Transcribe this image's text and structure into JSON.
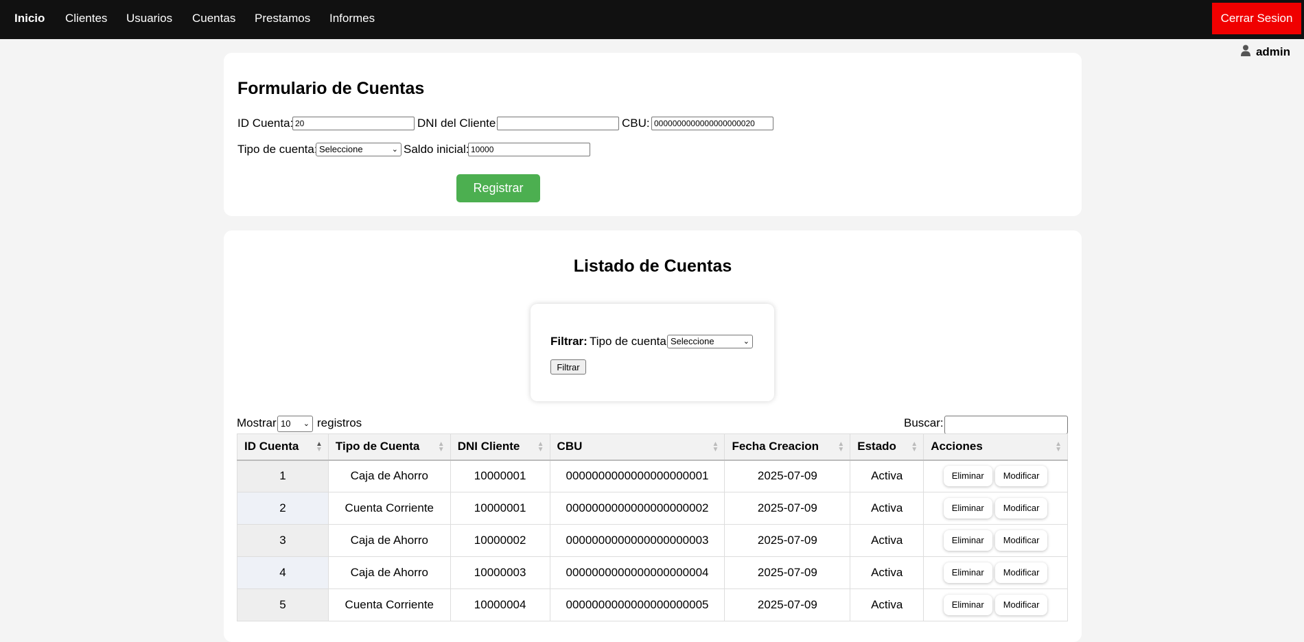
{
  "nav": {
    "items": [
      {
        "label": "Inicio",
        "active": true
      },
      {
        "label": "Clientes",
        "active": false
      },
      {
        "label": "Usuarios",
        "active": false
      },
      {
        "label": "Cuentas",
        "active": false
      },
      {
        "label": "Prestamos",
        "active": false
      },
      {
        "label": "Informes",
        "active": false
      }
    ],
    "logout_label": "Cerrar Sesion"
  },
  "user": {
    "name": "admin",
    "icon": "user-icon"
  },
  "form": {
    "title": "Formulario de Cuentas",
    "id_label": "ID Cuenta:",
    "id_value": "20",
    "dni_label": "DNI del Cliente:",
    "dni_value": "",
    "cbu_label": "CBU:",
    "cbu_value": "0000000000000000000020",
    "tipo_label": "Tipo de cuenta:",
    "tipo_value": "Seleccione",
    "saldo_label": "Saldo inicial:",
    "saldo_value": "10000",
    "submit_label": "Registrar"
  },
  "list": {
    "title": "Listado de Cuentas",
    "filter": {
      "bold_label": "Filtrar:",
      "tipo_label": "Tipo de cuenta:",
      "tipo_value": "Seleccione",
      "button_label": "Filtrar"
    },
    "show_prefix": "Mostrar",
    "show_value": "10",
    "show_suffix": "registros",
    "search_label": "Buscar:",
    "search_value": "",
    "columns": [
      "ID Cuenta",
      "Tipo de Cuenta",
      "DNI Cliente",
      "CBU",
      "Fecha Creacion",
      "Estado",
      "Acciones"
    ],
    "rows": [
      {
        "id": "1",
        "tipo": "Caja de Ahorro",
        "dni": "10000001",
        "cbu": "0000000000000000000001",
        "fecha": "2025-07-09",
        "estado": "Activa"
      },
      {
        "id": "2",
        "tipo": "Cuenta Corriente",
        "dni": "10000001",
        "cbu": "0000000000000000000002",
        "fecha": "2025-07-09",
        "estado": "Activa"
      },
      {
        "id": "3",
        "tipo": "Caja de Ahorro",
        "dni": "10000002",
        "cbu": "0000000000000000000003",
        "fecha": "2025-07-09",
        "estado": "Activa"
      },
      {
        "id": "4",
        "tipo": "Caja de Ahorro",
        "dni": "10000003",
        "cbu": "0000000000000000000004",
        "fecha": "2025-07-09",
        "estado": "Activa"
      },
      {
        "id": "5",
        "tipo": "Cuenta Corriente",
        "dni": "10000004",
        "cbu": "0000000000000000000005",
        "fecha": "2025-07-09",
        "estado": "Activa"
      }
    ],
    "action_delete": "Eliminar",
    "action_edit": "Modificar"
  },
  "colors": {
    "navbar": "#111111",
    "logout": "#f00000",
    "register": "#4caf50",
    "background": "#f4f4f4"
  }
}
